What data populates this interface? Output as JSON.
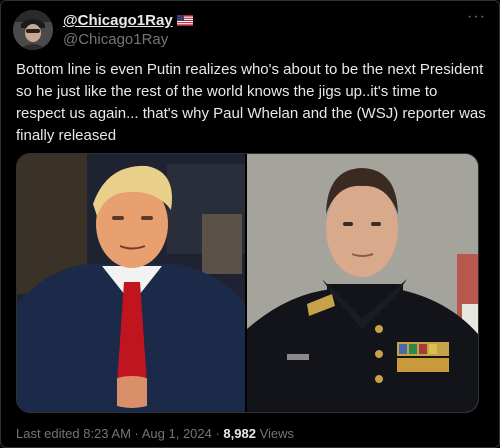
{
  "post": {
    "display_name": "@Chicago1Ray",
    "handle": "@Chicago1Ray",
    "more_label": "···",
    "text": "Bottom line is even Putin realizes who's about to be the next President so he just like the rest of the world knows the jigs up..it's time to respect us again... that's why Paul Whelan and the (WSJ) reporter was finally released",
    "media": [
      "left-photo",
      "right-photo"
    ],
    "footer": {
      "edited": "Last edited 8:23 AM · Aug 1, 2024 · ",
      "views_count": "8,982",
      "views_label": " Views"
    }
  },
  "icons": {
    "flag": "us-flag-icon",
    "more": "more-options-icon"
  },
  "colors": {
    "background": "#000000",
    "text": "#e7e9ea",
    "muted": "#71767b",
    "border": "#2f3336"
  }
}
